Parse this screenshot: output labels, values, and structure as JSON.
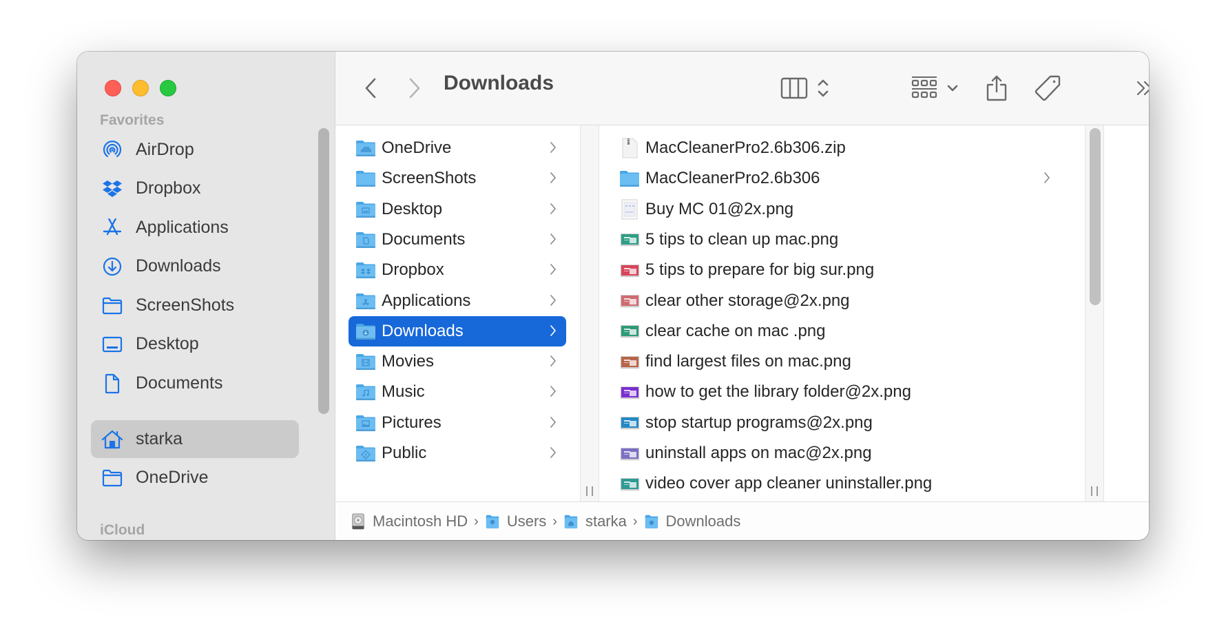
{
  "window": {
    "title": "Downloads",
    "traffic_lights": {
      "close": "#fe5f57",
      "minimize": "#febc2e",
      "zoom": "#28c840"
    }
  },
  "toolbar": {
    "back_icon": "chevron-left-icon",
    "forward_icon": "chevron-right-icon",
    "title": "Downloads",
    "view_mode_icon": "column-view-icon",
    "group_icon": "grid-group-icon",
    "share_icon": "share-icon",
    "tag_icon": "tag-icon",
    "more_icon": "double-chevron-icon",
    "search_icon": "search-icon"
  },
  "sidebar": {
    "sections": [
      {
        "label": "Favorites"
      },
      {
        "label": "iCloud"
      }
    ],
    "items": [
      {
        "label": "AirDrop",
        "icon": "airdrop-icon",
        "selected": false
      },
      {
        "label": "Dropbox",
        "icon": "dropbox-icon",
        "selected": false
      },
      {
        "label": "Applications",
        "icon": "applications-icon",
        "selected": false
      },
      {
        "label": "Downloads",
        "icon": "download-circle-icon",
        "selected": false
      },
      {
        "label": "ScreenShots",
        "icon": "folder-icon",
        "selected": false
      },
      {
        "label": "Desktop",
        "icon": "desktop-icon",
        "selected": false
      },
      {
        "label": "Documents",
        "icon": "document-icon",
        "selected": false
      },
      {
        "label": "starka",
        "icon": "home-icon",
        "selected": true
      },
      {
        "label": "OneDrive",
        "icon": "folder-icon",
        "selected": false
      }
    ],
    "accent": "#1a73e8"
  },
  "column1": {
    "items": [
      {
        "label": "OneDrive",
        "icon": "cloud-folder-icon",
        "selected": false
      },
      {
        "label": "ScreenShots",
        "icon": "folder-icon",
        "selected": false
      },
      {
        "label": "Desktop",
        "icon": "desktop-folder-icon",
        "selected": false
      },
      {
        "label": "Documents",
        "icon": "documents-folder-icon",
        "selected": false
      },
      {
        "label": "Dropbox",
        "icon": "dropbox-folder-icon",
        "selected": false
      },
      {
        "label": "Applications",
        "icon": "applications-folder-icon",
        "selected": false
      },
      {
        "label": "Downloads",
        "icon": "downloads-folder-icon",
        "selected": true
      },
      {
        "label": "Movies",
        "icon": "movies-folder-icon",
        "selected": false
      },
      {
        "label": "Music",
        "icon": "music-folder-icon",
        "selected": false
      },
      {
        "label": "Pictures",
        "icon": "pictures-folder-icon",
        "selected": false
      },
      {
        "label": "Public",
        "icon": "public-folder-icon",
        "selected": false
      }
    ],
    "selection_color": "#1768d9"
  },
  "column2": {
    "items": [
      {
        "label": "MacCleanerPro2.6b306.zip",
        "icon": "zip-file-icon",
        "is_folder": false
      },
      {
        "label": "MacCleanerPro2.6b306",
        "icon": "folder-icon",
        "is_folder": true
      },
      {
        "label": "Buy MC 01@2x.png",
        "icon": "image-file-icon",
        "is_folder": false,
        "thumb": "#f2f2f4"
      },
      {
        "label": "5 tips to clean up mac.png",
        "icon": "image-file-icon",
        "is_folder": false,
        "thumb": "#2f9e86"
      },
      {
        "label": "5 tips to prepare for big sur.png",
        "icon": "image-file-icon",
        "is_folder": false,
        "thumb": "#d8455a"
      },
      {
        "label": "clear other storage@2x.png",
        "icon": "image-file-icon",
        "is_folder": false,
        "thumb": "#cf6b72"
      },
      {
        "label": "clear cache on mac .png",
        "icon": "image-file-icon",
        "is_folder": false,
        "thumb": "#2f9a78"
      },
      {
        "label": "find largest files on mac.png",
        "icon": "image-file-icon",
        "is_folder": false,
        "thumb": "#b9654a"
      },
      {
        "label": "how to get the library folder@2x.png",
        "icon": "image-file-icon",
        "is_folder": false,
        "thumb": "#7a2fd0"
      },
      {
        "label": "stop startup programs@2x.png",
        "icon": "image-file-icon",
        "is_folder": false,
        "thumb": "#2389c4"
      },
      {
        "label": "uninstall apps on mac@2x.png",
        "icon": "image-file-icon",
        "is_folder": false,
        "thumb": "#7b6fc4"
      },
      {
        "label": "video cover app cleaner uninstaller.png",
        "icon": "image-file-icon",
        "is_folder": false,
        "thumb": "#2e9a94"
      }
    ]
  },
  "pathbar": {
    "crumbs": [
      {
        "label": "Macintosh HD",
        "icon": "hard-drive-icon"
      },
      {
        "label": "Users",
        "icon": "users-folder-icon"
      },
      {
        "label": "starka",
        "icon": "home-folder-icon"
      },
      {
        "label": "Downloads",
        "icon": "downloads-folder-icon"
      }
    ],
    "separator": "›"
  }
}
